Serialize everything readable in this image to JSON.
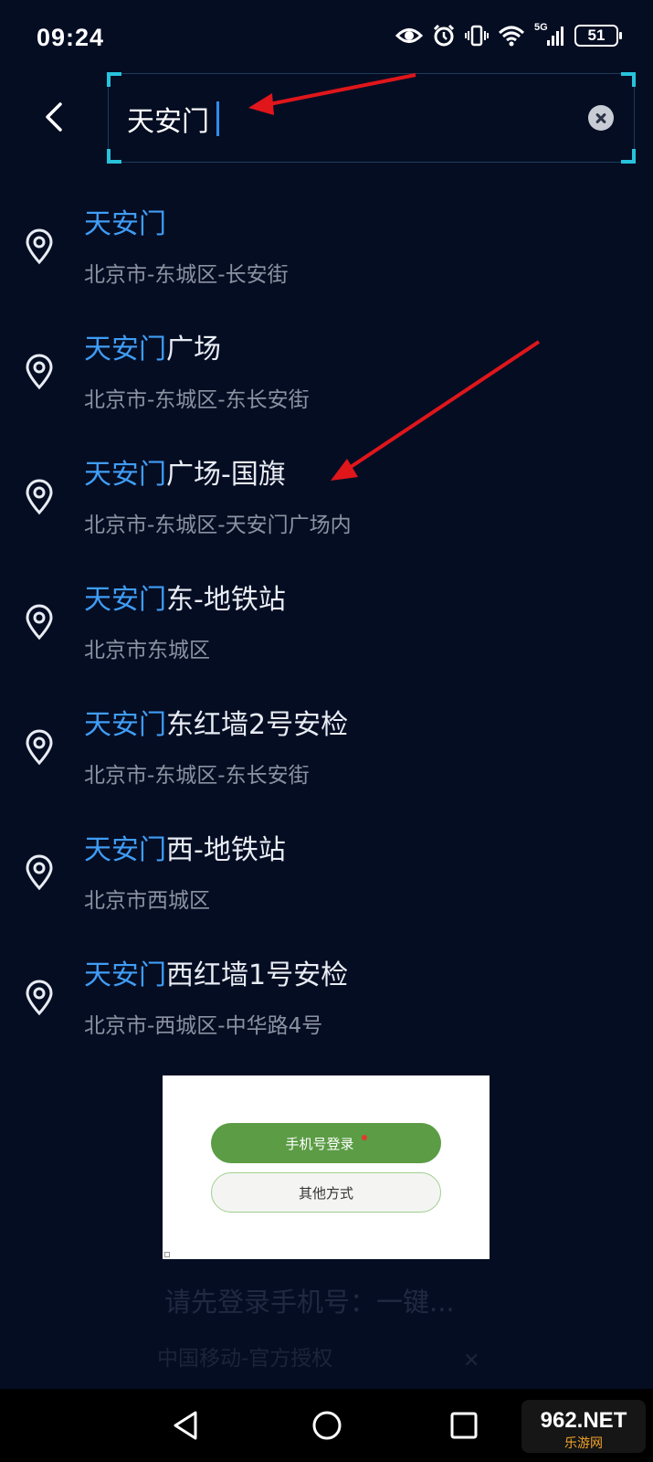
{
  "status_bar": {
    "time": "09:24",
    "network": "5G",
    "battery": "51",
    "icons": [
      "eye-icon",
      "alarm-icon",
      "vibrate-icon",
      "wifi-icon",
      "signal-icon",
      "battery-icon"
    ]
  },
  "search": {
    "value": "天安门",
    "icons": [
      "back-arrow-icon",
      "clear-icon"
    ]
  },
  "theme": {
    "background": "#050d23",
    "highlight": "#3f9df5",
    "frame_accent": "#27c3dc",
    "subtext": "#8b93a2"
  },
  "results": [
    {
      "match": "天安门",
      "rest": "",
      "address": "北京市-东城区-长安街"
    },
    {
      "match": "天安门",
      "rest": "广场",
      "address": "北京市-东城区-东长安街"
    },
    {
      "match": "天安门",
      "rest": "广场-国旗",
      "address": "北京市-东城区-天安门广场内"
    },
    {
      "match": "天安门",
      "rest": "东-地铁站",
      "address": "北京市东城区"
    },
    {
      "match": "天安门",
      "rest": "东红墙2号安检",
      "address": "北京市-东城区-东长安街"
    },
    {
      "match": "天安门",
      "rest": "西-地铁站",
      "address": "北京市西城区"
    },
    {
      "match": "天安门",
      "rest": "西红墙1号安检",
      "address": "北京市-西城区-中华路4号"
    }
  ],
  "ad": {
    "primary_label": "手机号登录",
    "secondary_label": "其他方式",
    "primary_color": "#5b9c45"
  },
  "background_prompt": {
    "title": "请先登录手机号：一键...",
    "subtitle": "中国移动-官方授权"
  },
  "navbar": {
    "buttons": [
      "back-triangle-icon",
      "home-circle-icon",
      "recents-square-icon"
    ]
  },
  "watermark": {
    "brand": "962.NET",
    "caption": "乐游网"
  }
}
